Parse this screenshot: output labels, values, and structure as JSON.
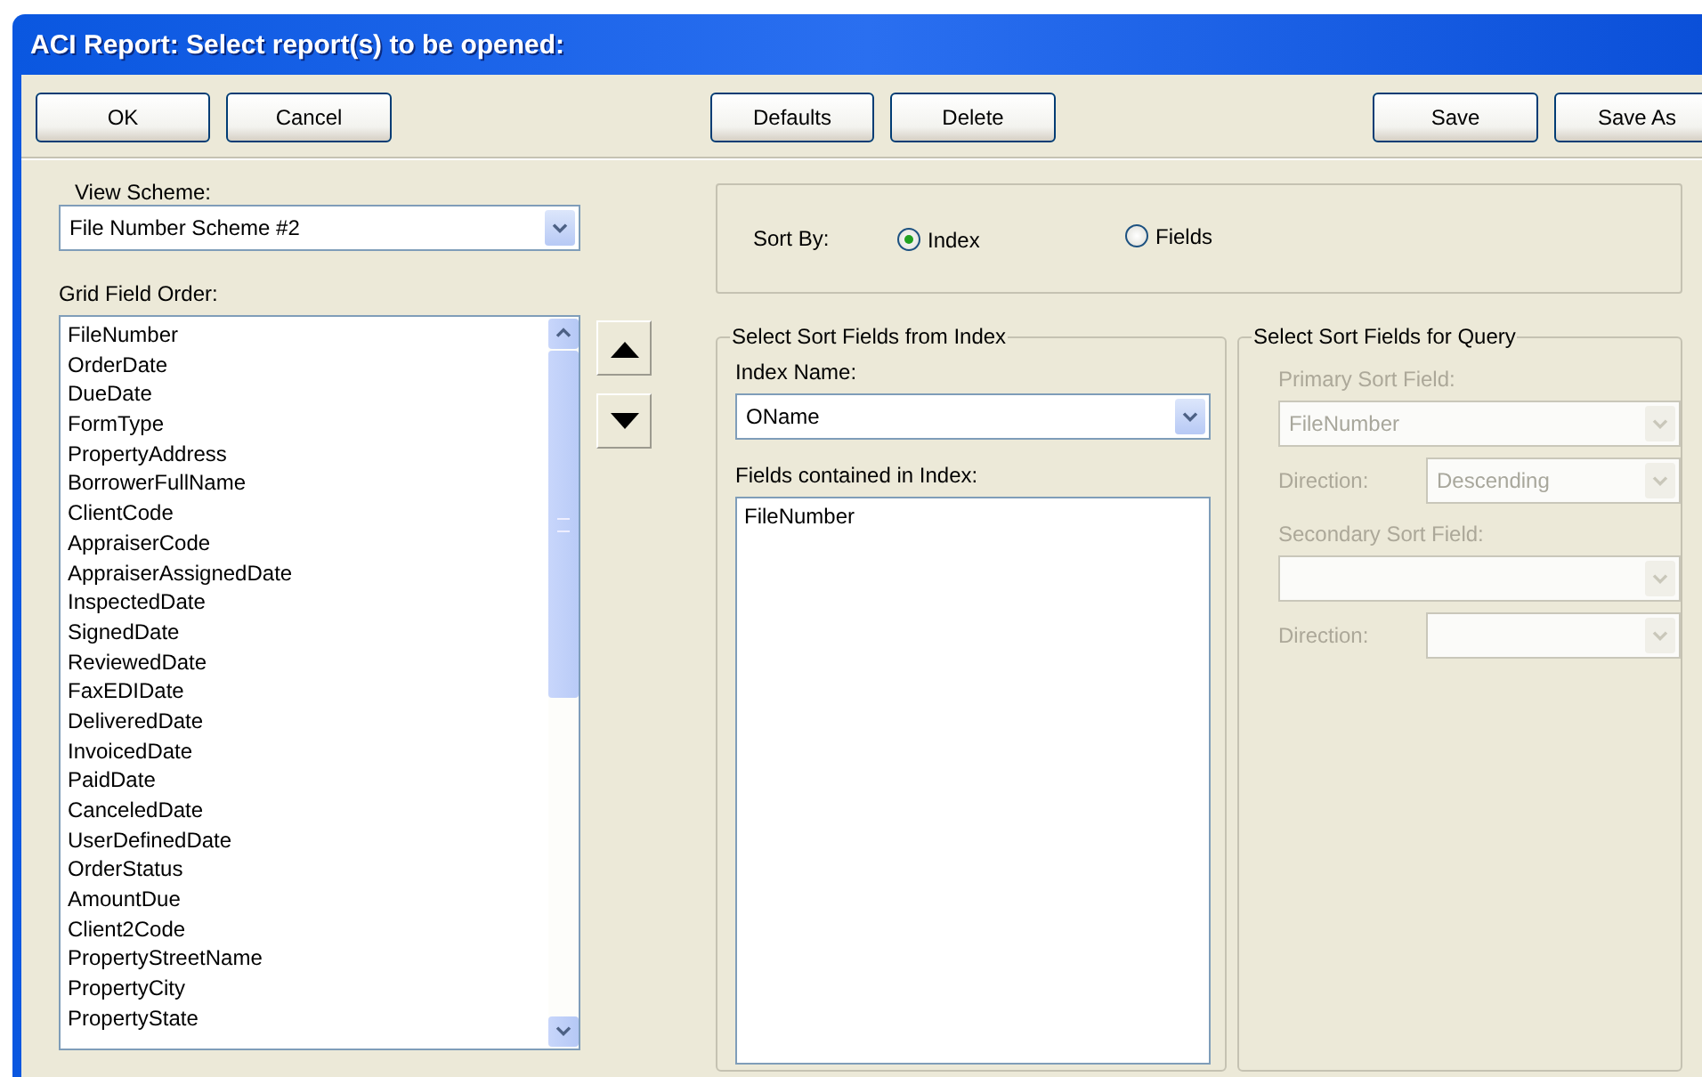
{
  "window": {
    "title": "ACI Report: Select report(s) to be opened:"
  },
  "toolbar": {
    "left": [
      "OK",
      "Cancel"
    ],
    "middle": [
      "Defaults",
      "Delete"
    ],
    "right": [
      "Save",
      "Save As"
    ]
  },
  "view_scheme": {
    "label": "View Scheme:",
    "value": "File Number Scheme #2"
  },
  "grid_field_order": {
    "label": "Grid Field Order:",
    "items": [
      "FileNumber",
      "OrderDate",
      "DueDate",
      "FormType",
      "PropertyAddress",
      "BorrowerFullName",
      "ClientCode",
      "AppraiserCode",
      "AppraiserAssignedDate",
      "InspectedDate",
      "SignedDate",
      "ReviewedDate",
      "FaxEDIDate",
      "DeliveredDate",
      "InvoicedDate",
      "PaidDate",
      "CanceledDate",
      "UserDefinedDate",
      "OrderStatus",
      "AmountDue",
      "Client2Code",
      "PropertyStreetName",
      "PropertyCity",
      "PropertyState"
    ]
  },
  "sort_by": {
    "label": "Sort By:",
    "options": [
      {
        "label": "Index",
        "selected": true
      },
      {
        "label": "Fields",
        "selected": false
      }
    ]
  },
  "index_section": {
    "title": "Select Sort Fields from Index",
    "index_name": {
      "label": "Index Name:",
      "value": "OName"
    },
    "fields": {
      "label": "Fields contained in Index:",
      "items": [
        "FileNumber"
      ]
    }
  },
  "query_section": {
    "title": "Select Sort Fields for Query",
    "disabled": true,
    "primary": {
      "label": "Primary Sort Field:",
      "value": "FileNumber",
      "direction_label": "Direction:",
      "direction": "Descending"
    },
    "secondary": {
      "label": "Secondary Sort Field:",
      "direction_label": "Direction:"
    }
  }
}
